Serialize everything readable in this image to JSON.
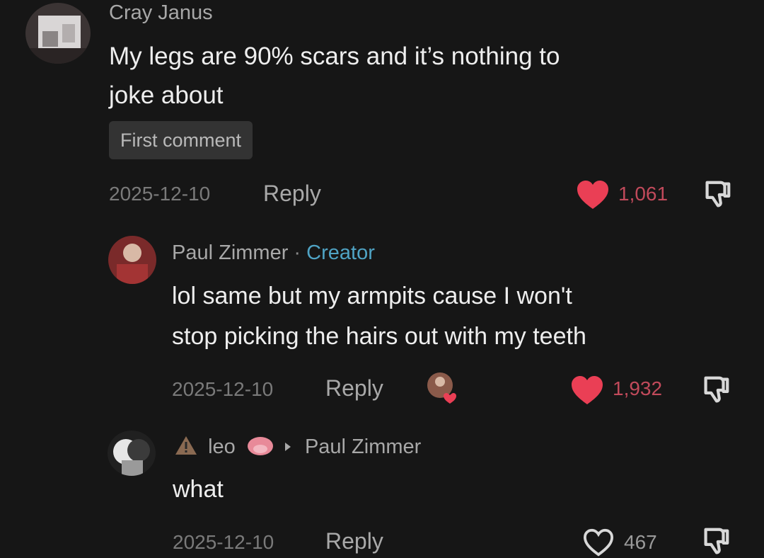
{
  "comments": [
    {
      "author": "Cray Janus",
      "text_lines": [
        "My legs are 90% scars and it’s nothing to",
        "joke about"
      ],
      "badge": "First comment",
      "date": "2025-12-10",
      "reply_label": "Reply",
      "likes": "1,061",
      "liked": true
    },
    {
      "author": "Paul Zimmer",
      "separator": "·",
      "role": "Creator",
      "text_lines": [
        "lol same but my armpits cause I won't",
        "stop picking the hairs out with my teeth"
      ],
      "date": "2025-12-10",
      "reply_label": "Reply",
      "likes": "1,932",
      "liked": true,
      "liked_by_creator": true
    },
    {
      "author": "leo",
      "reply_to": "Paul Zimmer",
      "text_lines": [
        "what"
      ],
      "date": "2025-12-10",
      "reply_label": "Reply",
      "likes": "467",
      "liked": false
    }
  ],
  "colors": {
    "background": "#161616",
    "like_active": "#ea3f55",
    "creator_label": "#4fa3c4"
  },
  "icons": {
    "like": "heart-icon",
    "dislike": "thumbs-down-icon",
    "reply_arrow": "caret-right-icon"
  }
}
